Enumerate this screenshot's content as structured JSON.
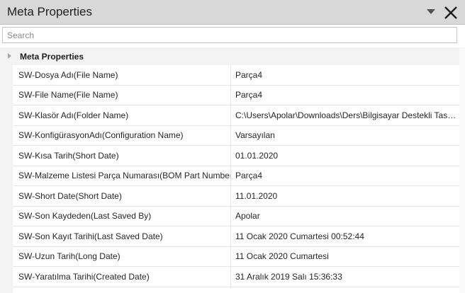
{
  "panel": {
    "title": "Meta Properties"
  },
  "search": {
    "placeholder": "Search",
    "value": ""
  },
  "category": {
    "label": "Meta Properties"
  },
  "properties": [
    {
      "name": "SW-Dosya Adı(File Name)",
      "value": "Parça4"
    },
    {
      "name": "SW-File Name(File Name)",
      "value": "Parça4"
    },
    {
      "name": "SW-Klasör Adı(Folder Name)",
      "value": "C:\\Users\\Apolar\\Downloads\\Ders\\Bilgisayar Destekli Tasar..."
    },
    {
      "name": "SW-KonfigürasyonAdı(Configuration Name)",
      "value": "Varsayılan"
    },
    {
      "name": "SW-Kısa Tarih(Short Date)",
      "value": "01.01.2020"
    },
    {
      "name": "SW-Malzeme Listesi Parça Numarası(BOM Part Number)",
      "value": "Parça4"
    },
    {
      "name": "SW-Short Date(Short Date)",
      "value": "11.01.2020"
    },
    {
      "name": "SW-Son Kaydeden(Last Saved By)",
      "value": "Apolar"
    },
    {
      "name": "SW-Son Kayıt Tarihi(Last Saved Date)",
      "value": "11 Ocak 2020 Cumartesi 00:52:44"
    },
    {
      "name": "SW-Uzun Tarih(Long Date)",
      "value": "11 Ocak 2020 Cumartesi"
    },
    {
      "name": "SW-Yaratılma Tarihi(Created Date)",
      "value": "31 Aralık 2019 Salı 15:36:33"
    }
  ],
  "icons": {
    "dropdown": "chevron-down-icon",
    "close": "close-icon",
    "expander": "triangle-expander-icon"
  }
}
